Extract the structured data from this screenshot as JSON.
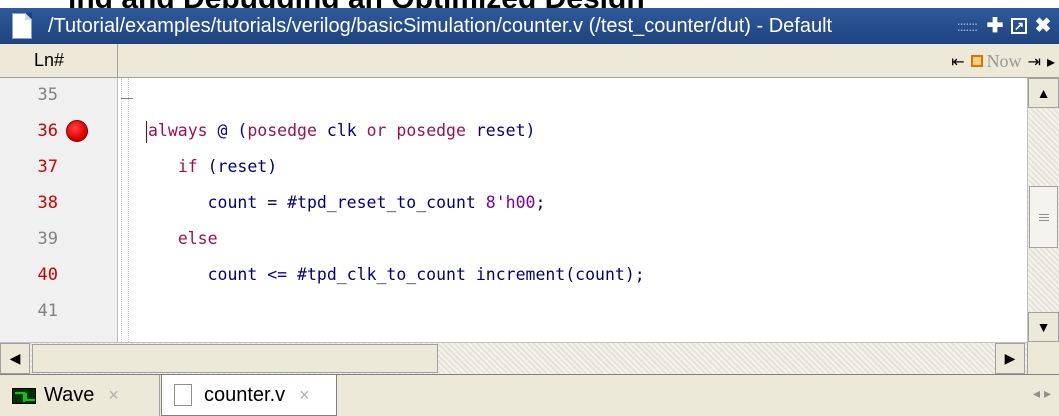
{
  "heading": "ing and Debugging an Optimized Design",
  "window": {
    "title": "/Tutorial/examples/tutorials/verilog/basicSimulation/counter.v (/test_counter/dut) - Default",
    "grip": ":::::::"
  },
  "header": {
    "ln_label": "Ln#",
    "now_label": "Now"
  },
  "lines": [
    {
      "num": "35",
      "executable": false,
      "breakpoint": false
    },
    {
      "num": "36",
      "executable": true,
      "breakpoint": true
    },
    {
      "num": "37",
      "executable": true,
      "breakpoint": false
    },
    {
      "num": "38",
      "executable": true,
      "breakpoint": false
    },
    {
      "num": "39",
      "executable": false,
      "breakpoint": false
    },
    {
      "num": "40",
      "executable": true,
      "breakpoint": false
    },
    {
      "num": "41",
      "executable": false,
      "breakpoint": false
    }
  ],
  "code": {
    "l36": {
      "kw1": "always",
      "at": " @ ",
      "paren": "(",
      "kw2": "posedge",
      "sig1": " clk ",
      "kw3": "or",
      "kw4": " posedge",
      "sig2": " reset",
      "close": ")"
    },
    "l37": {
      "indent": "   ",
      "kw": "if",
      "rest": " (reset)"
    },
    "l38": {
      "indent": "      ",
      "a": "count = #tpd_reset_to_count ",
      "num": "8'h00",
      "end": ";"
    },
    "l39": {
      "indent": "   ",
      "kw": "else"
    },
    "l40": {
      "indent": "      ",
      "a": "count ",
      "op": "<=",
      "b": " #tpd_clk_to_count increment(count);"
    }
  },
  "tabs": [
    {
      "label": "Wave",
      "close": "×"
    },
    {
      "label": "counter.v",
      "close": "×"
    }
  ],
  "icons": {
    "breakpoint_color": "#e00000",
    "titlebar_color": "#1e4280"
  }
}
